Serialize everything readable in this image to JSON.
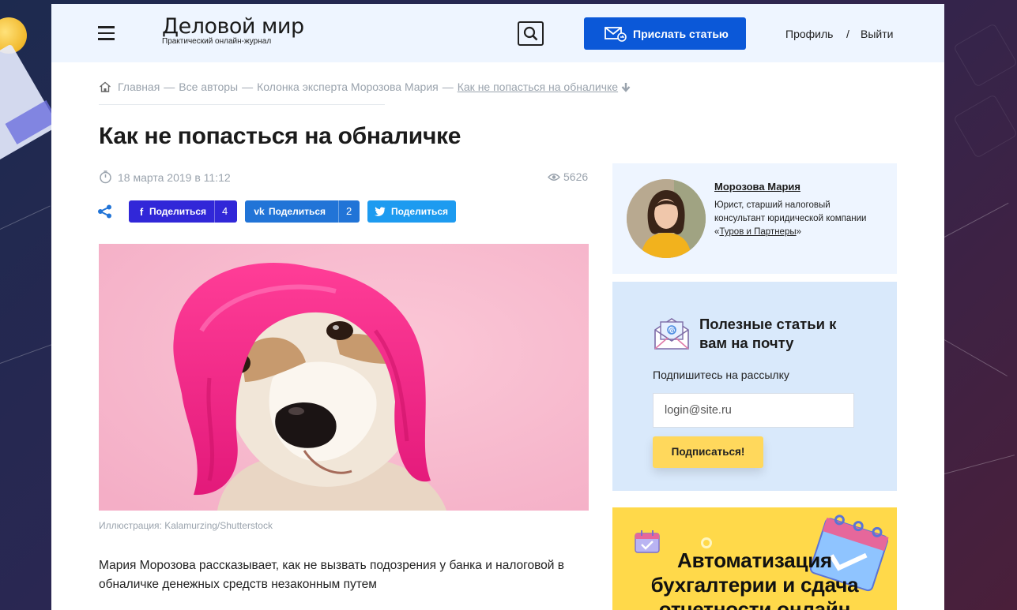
{
  "header": {
    "logo_main": "Деловой мир",
    "logo_sub": "Практический онлайн-журнал",
    "send_article": "Прислать статью",
    "profile": "Профиль",
    "separator": "/",
    "logout": "Выйти"
  },
  "breadcrumb": {
    "items": [
      "Главная",
      "Все авторы",
      "Колонка эксперта Морозова Мария",
      "Как не попасться на обналичке"
    ],
    "separator": "—"
  },
  "article": {
    "title": "Как не попасться на обналичке",
    "date": "18 марта 2019 в 11:12",
    "views": "5626",
    "share": {
      "facebook_label": "Поделиться",
      "facebook_count": "4",
      "vk_label": "Поделиться",
      "vk_count": "2",
      "twitter_label": "Поделиться"
    },
    "image_caption": "Иллюстрация: Kalamurzing/Shutterstock",
    "lead": "Мария Морозова рассказывает, как не вызвать подозрения у банка и налоговой в обналичке денежных средств незаконным путем"
  },
  "author": {
    "name": "Морозова Мария",
    "desc_prefix": "Юрист, старший налоговый консультант юридической компании «",
    "company": "Туров и Партнеры",
    "desc_suffix": "»"
  },
  "newsletter": {
    "title": "Полезные статьи к вам на почту",
    "subtitle": "Подпишитесь на рассылку",
    "placeholder": "login@site.ru",
    "button": "Подписаться!"
  },
  "promo": {
    "title": "Автоматизация бухгалтерии и сдача отчетности онлайн"
  },
  "colors": {
    "accent": "#0b58d8",
    "facebook": "#3127d8",
    "vk": "#2174d7",
    "twitter": "#1d9bf0",
    "subscribe": "#ffd85c",
    "promo_bg": "#ffd94a"
  },
  "icons": [
    "menu-icon",
    "search-icon",
    "mail-send-icon",
    "home-icon",
    "clock-icon",
    "eye-icon",
    "share-icon",
    "facebook-icon",
    "vk-icon",
    "twitter-icon",
    "envelope-icon",
    "calendar-icon"
  ]
}
